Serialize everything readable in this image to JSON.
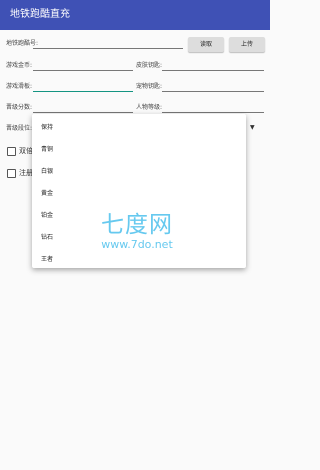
{
  "app": {
    "title": "地铁跑酷直充"
  },
  "form": {
    "account_label": "地铁跑酷号:",
    "read_button": "读取",
    "upload_button": "上传",
    "game_coins_label": "游戏金币:",
    "skin_key_label": "皮肤钥匙:",
    "game_skateboard_label": "游戏滑板:",
    "pet_key_label": "宠物钥匙:",
    "ranked_score_label": "晋级分数:",
    "character_level_label": "人物等级:",
    "rank_tier_label": "晋级段位:"
  },
  "checkboxes": [
    {
      "label": "双倍"
    },
    {
      "label": "注册"
    }
  ],
  "rank_tier_options": [
    "保持",
    "青铜",
    "白银",
    "黄金",
    "铂金",
    "钻石",
    "王者"
  ],
  "watermark": {
    "main": "七度网",
    "sub": "www.7do.net"
  },
  "colors": {
    "appbar": "#3f51b5",
    "focus_underline": "#149482",
    "watermark": "#66c9ef"
  }
}
